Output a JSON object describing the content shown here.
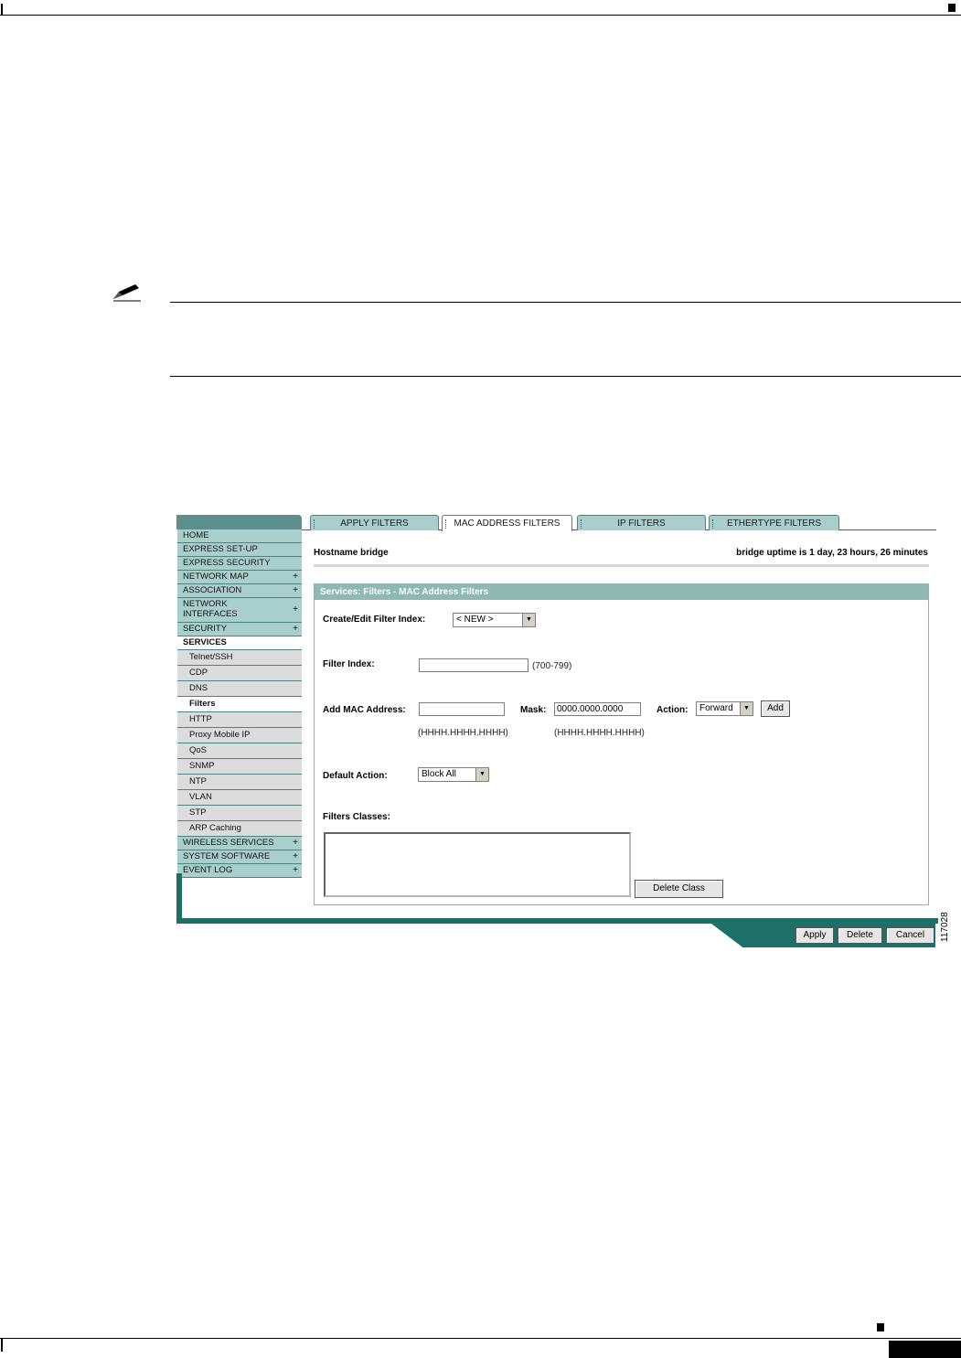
{
  "tabs": [
    "APPLY FILTERS",
    "MAC ADDRESS FILTERS",
    "IP FILTERS",
    "ETHERTYPE FILTERS"
  ],
  "active_tab": "MAC ADDRESS FILTERS",
  "nav": {
    "items": [
      {
        "label": "HOME",
        "plus": ""
      },
      {
        "label": "EXPRESS SET-UP",
        "plus": ""
      },
      {
        "label": "EXPRESS SECURITY",
        "plus": ""
      },
      {
        "label": "NETWORK MAP",
        "plus": "+"
      },
      {
        "label": "ASSOCIATION",
        "plus": "+"
      },
      {
        "label": "NETWORK INTERFACES",
        "plus": "+"
      },
      {
        "label": "SECURITY",
        "plus": "+"
      },
      {
        "label": "SERVICES",
        "plus": ""
      }
    ],
    "sub_items": [
      "Telnet/SSH",
      "CDP",
      "DNS",
      "Filters",
      "HTTP",
      "Proxy Mobile IP",
      "QoS",
      "SNMP",
      "NTP",
      "VLAN",
      "STP",
      "ARP Caching"
    ],
    "bottom_items": [
      {
        "label": "WIRELESS SERVICES",
        "plus": "+"
      },
      {
        "label": "SYSTEM SOFTWARE",
        "plus": "+"
      },
      {
        "label": "EVENT LOG",
        "plus": "+"
      }
    ]
  },
  "header": {
    "hostname": "Hostname  bridge",
    "uptime": "bridge uptime is 1 day, 23 hours, 26 minutes"
  },
  "panel": {
    "title": "Services: Filters - MAC Address Filters",
    "create_edit_label": "Create/Edit Filter Index:",
    "create_edit_value": "< NEW >",
    "filter_index_label": "Filter Index:",
    "filter_index_value": "",
    "filter_index_range": "(700-799)",
    "add_mac_label": "Add MAC Address:",
    "mac_value": "",
    "mac_hint": "(HHHH.HHHH.HHHH)",
    "mask_label": "Mask:",
    "mask_value": "0000.0000.0000",
    "mask_hint": "(HHHH.HHHH.HHHH)",
    "action_label": "Action:",
    "action_value": "Forward",
    "add_button": "Add",
    "default_action_label": "Default Action:",
    "default_action_value": "Block All",
    "filters_classes_label": "Filters Classes:",
    "delete_class_button": "Delete Class"
  },
  "footer_buttons": {
    "apply": "Apply",
    "delete": "Delete",
    "cancel": "Cancel"
  },
  "figure_number": "117028"
}
